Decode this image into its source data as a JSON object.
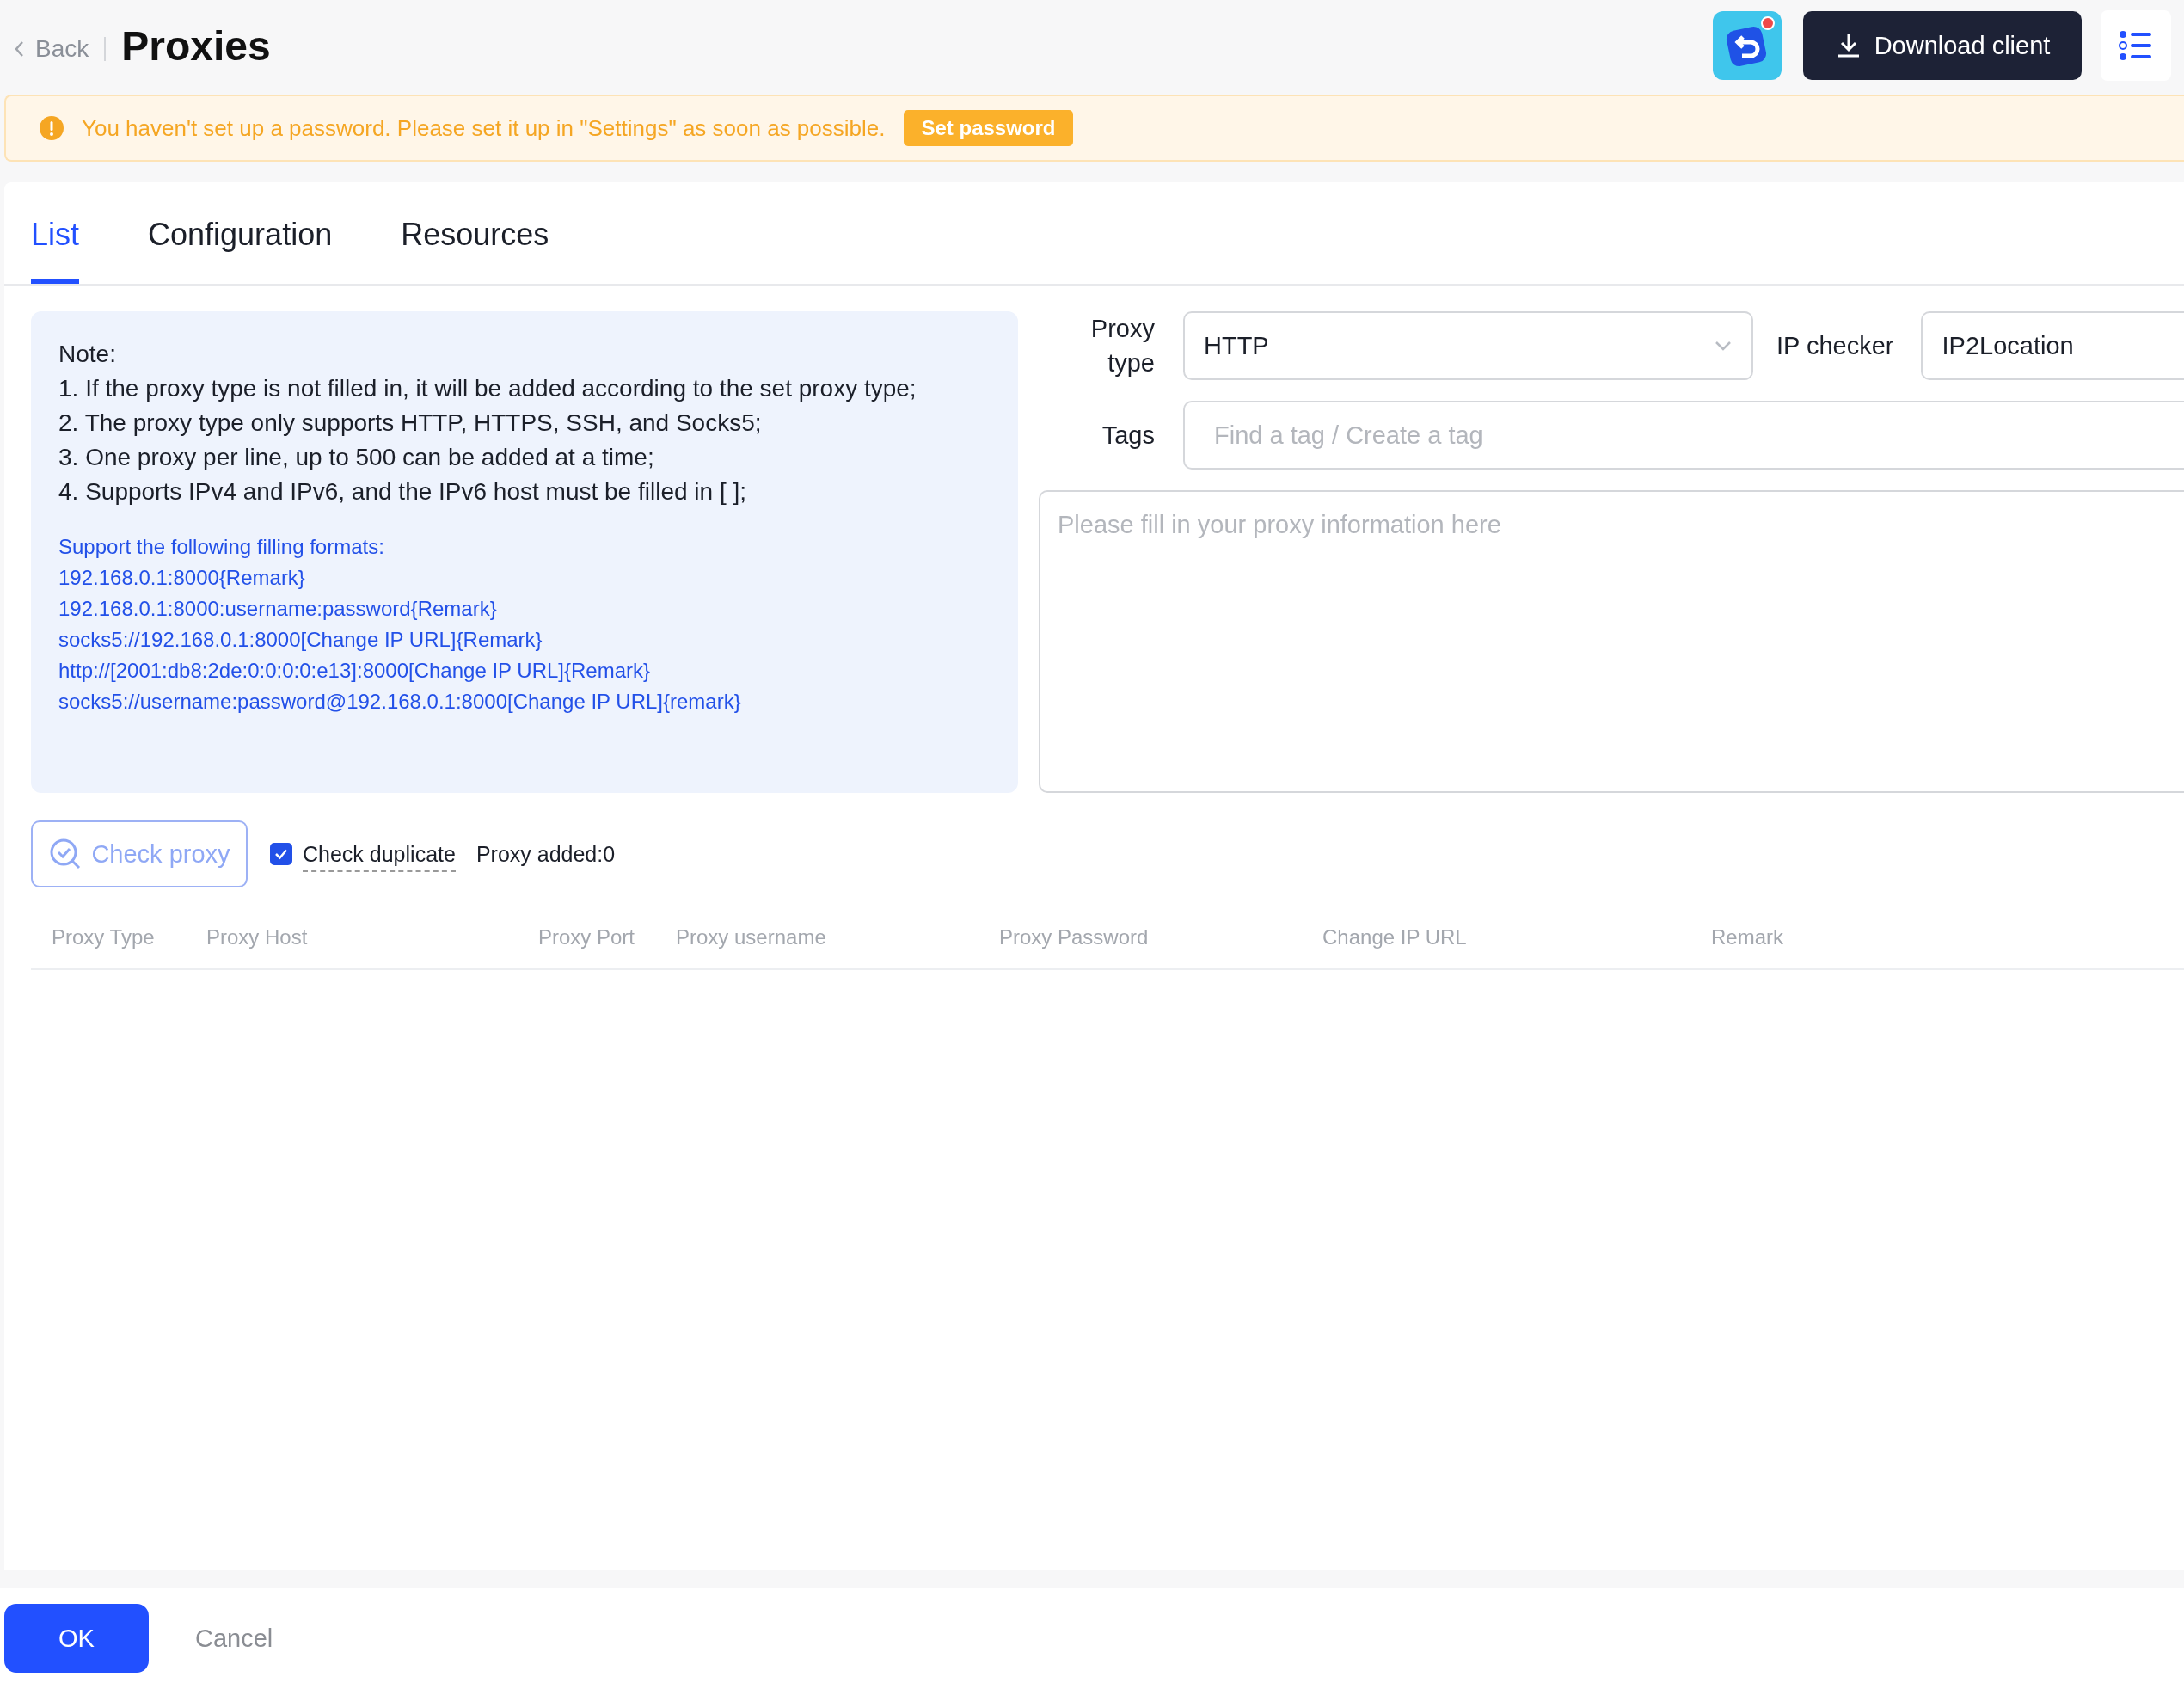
{
  "header": {
    "back": "Back",
    "title": "Proxies",
    "download_button": "Download client"
  },
  "warning": {
    "text": "You haven't set up a password. Please set it up in \"Settings\" as soon as possible.",
    "button": "Set password"
  },
  "tabs": [
    {
      "label": "List",
      "selected": true
    },
    {
      "label": "Configuration",
      "selected": false
    },
    {
      "label": "Resources",
      "selected": false
    }
  ],
  "note": {
    "title": "Note:",
    "lines": [
      "1. If the proxy type is not filled in, it will be added according to the set proxy type;",
      "2. The proxy type only supports HTTP, HTTPS, SSH, and Socks5;",
      "3. One proxy per line, up to 500 can be added at a time;",
      "4. Supports IPv4 and IPv6, and the IPv6 host must be filled in [ ];"
    ],
    "formats_title": "Support the following filling formats:",
    "formats": [
      "192.168.0.1:8000{Remark}",
      "192.168.0.1:8000:username:password{Remark}",
      "socks5://192.168.0.1:8000[Change IP URL]{Remark}",
      "http://[2001:db8:2de:0:0:0:0:e13]:8000[Change IP URL]{Remark}",
      "socks5://username:password@192.168.0.1:8000[Change IP URL]{remark}"
    ]
  },
  "form": {
    "proxy_type": {
      "label": "Proxy type",
      "value": "HTTP"
    },
    "ip_checker": {
      "label": "IP checker",
      "value": "IP2Location"
    },
    "tags": {
      "label": "Tags",
      "placeholder": "Find a tag / Create a tag"
    },
    "proxy_text": {
      "placeholder": "Please fill in your proxy information here"
    }
  },
  "actions": {
    "check_button": "Check proxy",
    "check_duplicate": {
      "label": "Check duplicate",
      "checked": true
    },
    "proxy_added": "Proxy added:0"
  },
  "table": {
    "columns": [
      "Proxy Type",
      "Proxy Host",
      "Proxy Port",
      "Proxy username",
      "Proxy Password",
      "Change IP URL",
      "Remark"
    ]
  },
  "footer": {
    "ok": "OK",
    "cancel": "Cancel"
  }
}
